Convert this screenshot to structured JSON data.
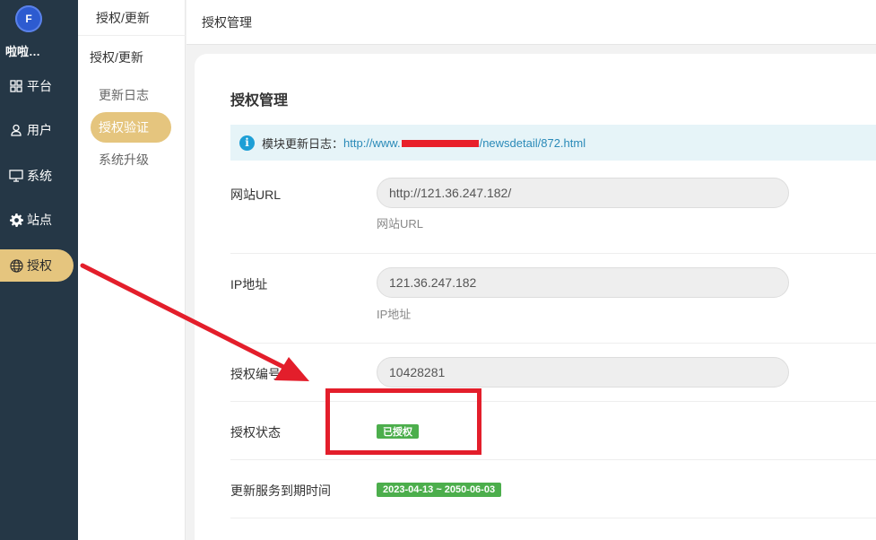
{
  "sidebar": {
    "logo_text": "F",
    "brand": "啦啦…",
    "items": [
      {
        "label": "平台",
        "icon": "grid-icon"
      },
      {
        "label": "用户",
        "icon": "user-icon"
      },
      {
        "label": "系统",
        "icon": "monitor-icon"
      },
      {
        "label": "站点",
        "icon": "gear-icon"
      },
      {
        "label": "授权",
        "icon": "globe-icon",
        "active": true
      }
    ]
  },
  "submenu": {
    "header": "授权/更新",
    "title": "授权/更新",
    "items": [
      {
        "label": "更新日志"
      },
      {
        "label": "授权验证",
        "active": true
      },
      {
        "label": "系统升级"
      }
    ]
  },
  "topbar": {
    "title": "授权管理"
  },
  "main": {
    "title": "授权管理",
    "notice": {
      "prefix": "模块更新日志：",
      "link_start": "http://www.",
      "link_end": "/newsdetail/872.html"
    },
    "rows": [
      {
        "label": "网站URL",
        "value": "http://121.36.247.182/",
        "hint": "网站URL"
      },
      {
        "label": "IP地址",
        "value": "121.36.247.182",
        "hint": "IP地址"
      },
      {
        "label": "授权编号",
        "value": "10428281"
      },
      {
        "label": "授权状态",
        "badge": "已授权"
      },
      {
        "label": "更新服务到期时间",
        "badge": "2023-04-13 ~ 2050-06-03"
      }
    ]
  },
  "colors": {
    "sidebar_bg": "#253746",
    "accent": "#e5c57e",
    "success": "#4cae4c",
    "annotation": "#e31e2b"
  }
}
